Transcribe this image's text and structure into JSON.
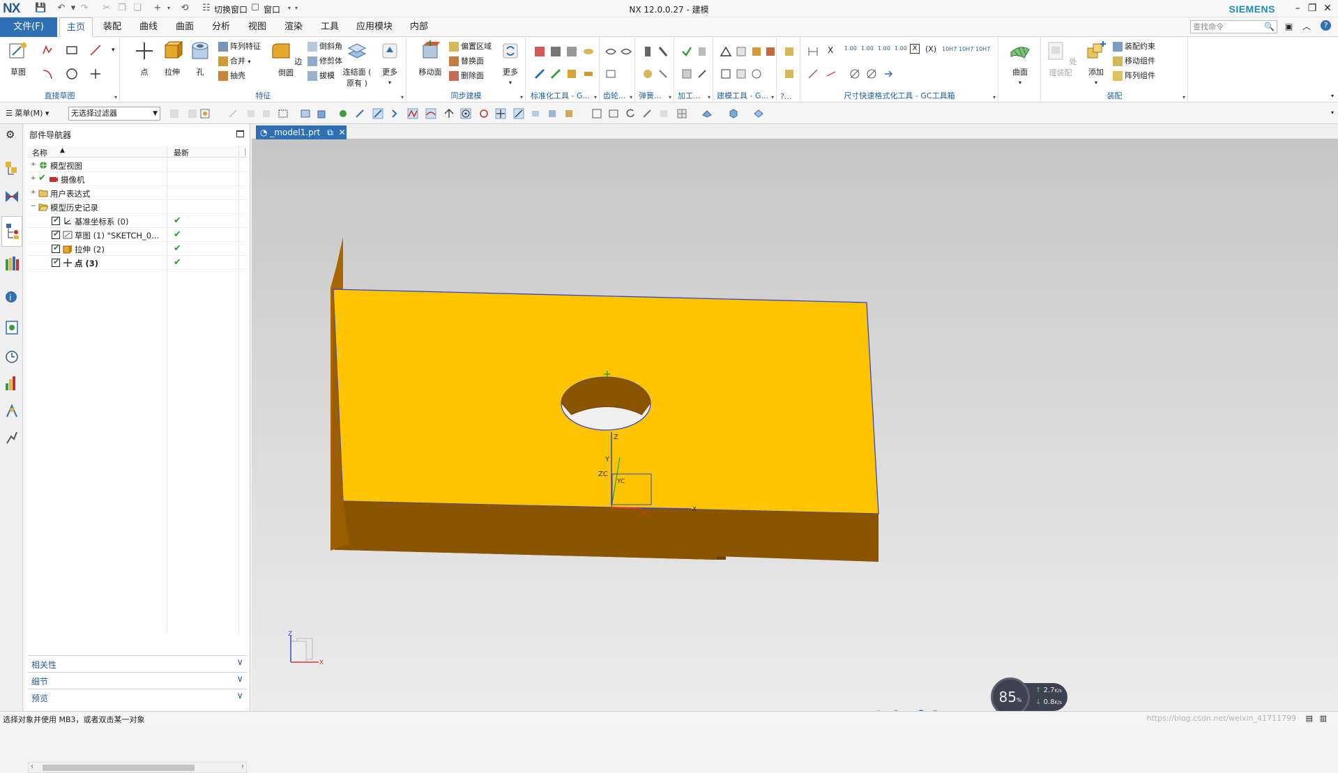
{
  "app": {
    "logo": "NX",
    "title": "NX 12.0.0.27 - 建模",
    "brand": "SIEMENS",
    "quick_access": {
      "switch_window": "切换窗口",
      "window": "窗口"
    }
  },
  "menubar": {
    "file": "文件(F)",
    "tabs": [
      "主页",
      "装配",
      "曲线",
      "曲面",
      "分析",
      "视图",
      "渲染",
      "工具",
      "应用模块",
      "内部"
    ],
    "active_tab": "主页",
    "search_placeholder": "查找命令"
  },
  "ribbon": {
    "groups": {
      "direct_sketch": {
        "name": "直接草图",
        "sketch": "草图"
      },
      "feature": {
        "name": "特征",
        "point": "点",
        "extrude": "拉伸",
        "hole": "孔",
        "pattern_feature": "阵列特征",
        "unite": "合并",
        "shell": "抽壳",
        "edge_blend": "边倒圆",
        "chamfer": "倒斜角",
        "trim_body": "修剪体",
        "draft": "拔模",
        "offset_face": "连结面 (",
        "offset_face2": "原有 )",
        "more": "更多"
      },
      "sync": {
        "name": "同步建模",
        "move_face": "移动面",
        "offset_region": "偏置区域",
        "replace_face": "替换面",
        "delete_face": "删除面",
        "more": "更多"
      },
      "std_tools": {
        "name": "标准化工具 - G..."
      },
      "gear": {
        "name": "齿轮..."
      },
      "spring": {
        "name": "弹簧..."
      },
      "machining": {
        "name": "加工..."
      },
      "model_tools": {
        "name": "建模工具 - G..."
      },
      "q": {
        "name": "?..."
      },
      "dim_tools": {
        "name": "尺寸快速格式化工具 - GC工具箱"
      },
      "surface": {
        "name": "",
        "surface": "曲面"
      },
      "assembly": {
        "name": "装配",
        "process": "处理装配",
        "add": "添加",
        "constraint": "装配约束",
        "move": "移动组件",
        "pattern": "阵列组件"
      }
    }
  },
  "toolbar": {
    "menu": "菜单(M)",
    "filter": "无选择过滤器"
  },
  "navigator": {
    "title": "部件导航器",
    "columns": {
      "name": "名称",
      "latest": "最新"
    },
    "rows": [
      {
        "label": "模型视图",
        "type": "folder"
      },
      {
        "label": "摄像机",
        "type": "camera"
      },
      {
        "label": "用户表达式",
        "type": "folder"
      },
      {
        "label": "模型历史记录",
        "type": "folder-open"
      },
      {
        "label": "基准坐标系 (0)",
        "type": "feature"
      },
      {
        "label": "草图 (1) \"SKETCH_0...",
        "type": "feature"
      },
      {
        "label": "拉伸 (2)",
        "type": "feature"
      },
      {
        "label": "点 (3)",
        "type": "feature"
      }
    ],
    "panels": [
      "相关性",
      "细节",
      "预览"
    ]
  },
  "document": {
    "tab": "_model1.prt"
  },
  "csys": {
    "zc": "ZC",
    "yc": "YC",
    "xc": "XC",
    "x": "X",
    "y": "Y",
    "z": "Z"
  },
  "status": {
    "message": "选择对象并使用 MB3，或者双击某一对象",
    "watermark": "https://blog.csdn.net/weixin_41711799"
  },
  "speed": {
    "percent": "85",
    "up": "2.7",
    "down": "0.8",
    "unit": "K/s"
  },
  "colors": {
    "accent": "#2f6fb3",
    "part_top": "#ffc400",
    "part_side": "#8b5400",
    "edge": "#3a46c8"
  }
}
